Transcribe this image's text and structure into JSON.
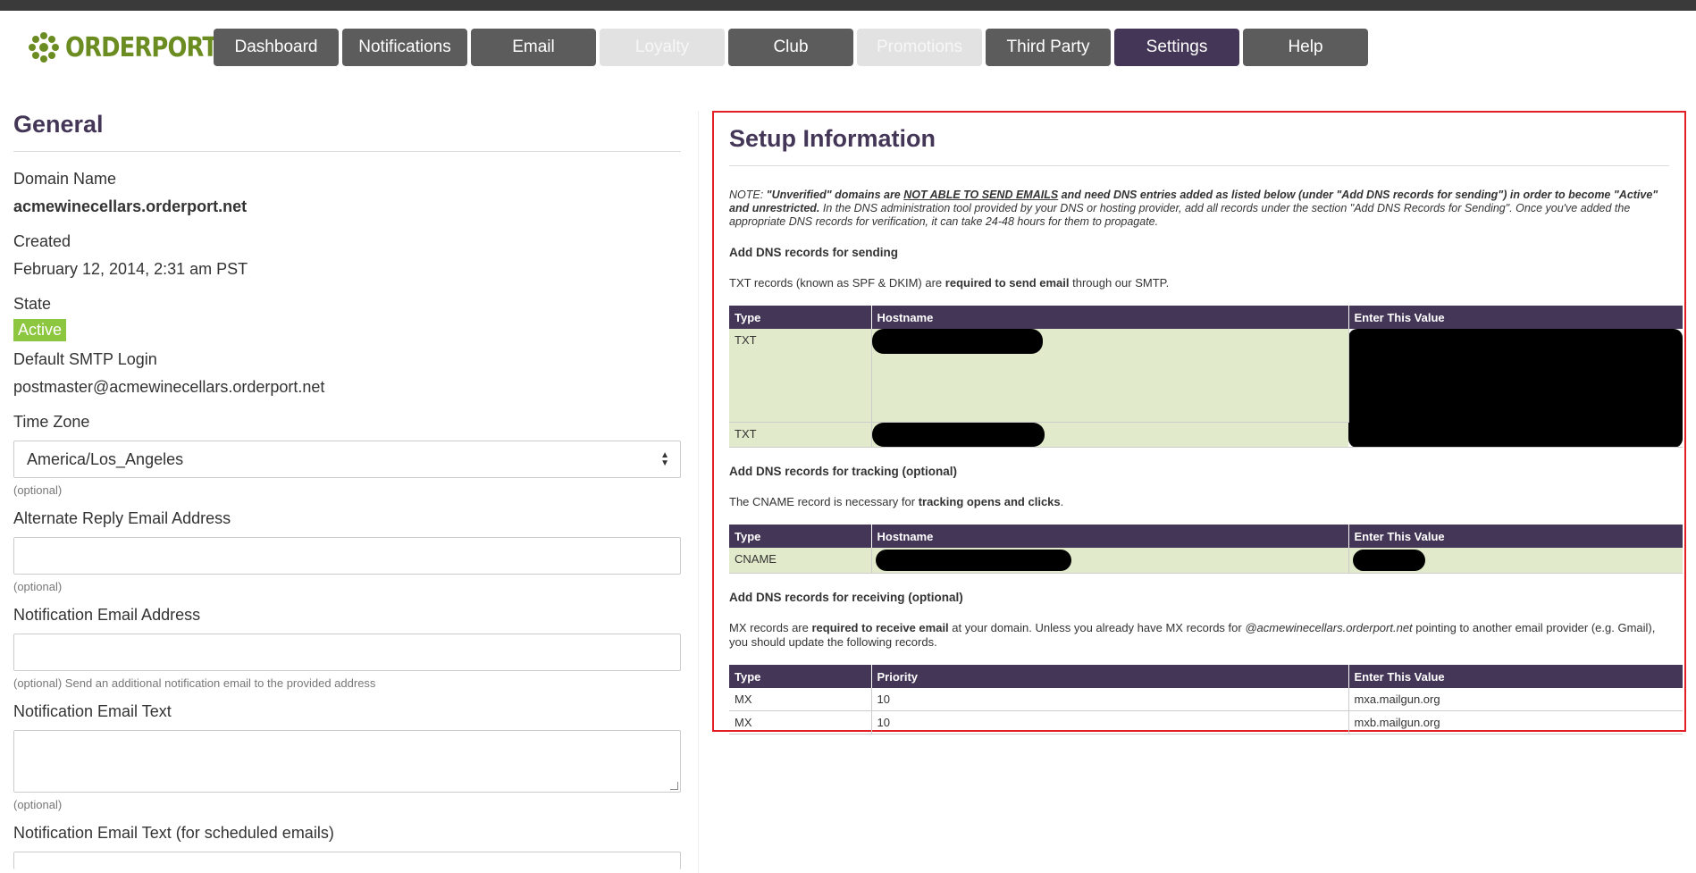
{
  "brand": {
    "logo_text": "ORDERPORT",
    "logo_color": "#6b8c21"
  },
  "nav": [
    {
      "label": "Dashboard",
      "state": "normal"
    },
    {
      "label": "Notifications",
      "state": "normal"
    },
    {
      "label": "Email",
      "state": "normal"
    },
    {
      "label": "Loyalty",
      "state": "disabled"
    },
    {
      "label": "Club",
      "state": "normal"
    },
    {
      "label": "Promotions",
      "state": "disabled"
    },
    {
      "label": "Third Party",
      "state": "normal"
    },
    {
      "label": "Settings",
      "state": "active"
    },
    {
      "label": "Help",
      "state": "normal"
    }
  ],
  "colors": {
    "accent": "#443657",
    "active_badge": "#8dc63f",
    "highlight_border": "#e31e24",
    "row_green": "#e1ebcb"
  },
  "general": {
    "title": "General",
    "domain_label": "Domain Name",
    "domain_value": "acmewinecellars.orderport.net",
    "created_label": "Created",
    "created_value": "February 12, 2014, 2:31 am PST",
    "state_label": "State",
    "state_value": "Active",
    "smtp_label": "Default SMTP Login",
    "smtp_value": "postmaster@acmewinecellars.orderport.net",
    "timezone_label": "Time Zone",
    "timezone_value": "America/Los_Angeles",
    "optional": "(optional)",
    "alt_reply_label": "Alternate Reply Email Address",
    "alt_reply_value": "",
    "notif_email_label": "Notification Email Address",
    "notif_email_value": "",
    "notif_email_help": "(optional) Send an additional notification email to the provided address",
    "notif_text_label": "Notification Email Text",
    "notif_text_value": "",
    "notif_sched_label": "Notification Email Text (for scheduled emails)"
  },
  "setup": {
    "title": "Setup Information",
    "note_prefix": "NOTE: ",
    "note_bold1": "\"Unverified\" domains are ",
    "note_underline": "NOT ABLE TO SEND EMAILS",
    "note_bold2": " and need DNS entries added as listed below (under \"Add DNS records for sending\") in order to become \"Active\" and unrestricted.",
    "note_rest": " In the DNS administration tool provided by your DNS or hosting provider, add all records under the section \"Add DNS Records for Sending\". Once you've added the appropriate DNS records for verification, it can take 24-48 hours for them to propagate.",
    "sending": {
      "heading": "Add DNS records for sending",
      "text_a": "TXT records (known as SPF & DKIM) are ",
      "text_b": "required to send email",
      "text_c": " through our SMTP.",
      "columns": [
        "Type",
        "Hostname",
        "Enter This Value"
      ],
      "rows": [
        {
          "type": "TXT"
        },
        {
          "type": "TXT"
        }
      ]
    },
    "tracking": {
      "heading": "Add DNS records for tracking (optional)",
      "text_a": "The CNAME record is necessary for ",
      "text_b": "tracking opens and clicks",
      "text_c": ".",
      "columns": [
        "Type",
        "Hostname",
        "Enter This Value"
      ],
      "rows": [
        {
          "type": "CNAME"
        }
      ]
    },
    "receiving": {
      "heading": "Add DNS records for receiving (optional)",
      "text_a": "MX records are ",
      "text_b": "required to receive email",
      "text_c": " at your domain. Unless you already have MX records for ",
      "text_d": "@acmewinecellars.orderport.net",
      "text_e": " pointing to another email provider (e.g. Gmail), you should update the following records.",
      "columns": [
        "Type",
        "Priority",
        "Enter This Value"
      ],
      "rows": [
        {
          "type": "MX",
          "priority": "10",
          "value": "mxa.mailgun.org"
        },
        {
          "type": "MX",
          "priority": "10",
          "value": "mxb.mailgun.org"
        }
      ]
    }
  }
}
